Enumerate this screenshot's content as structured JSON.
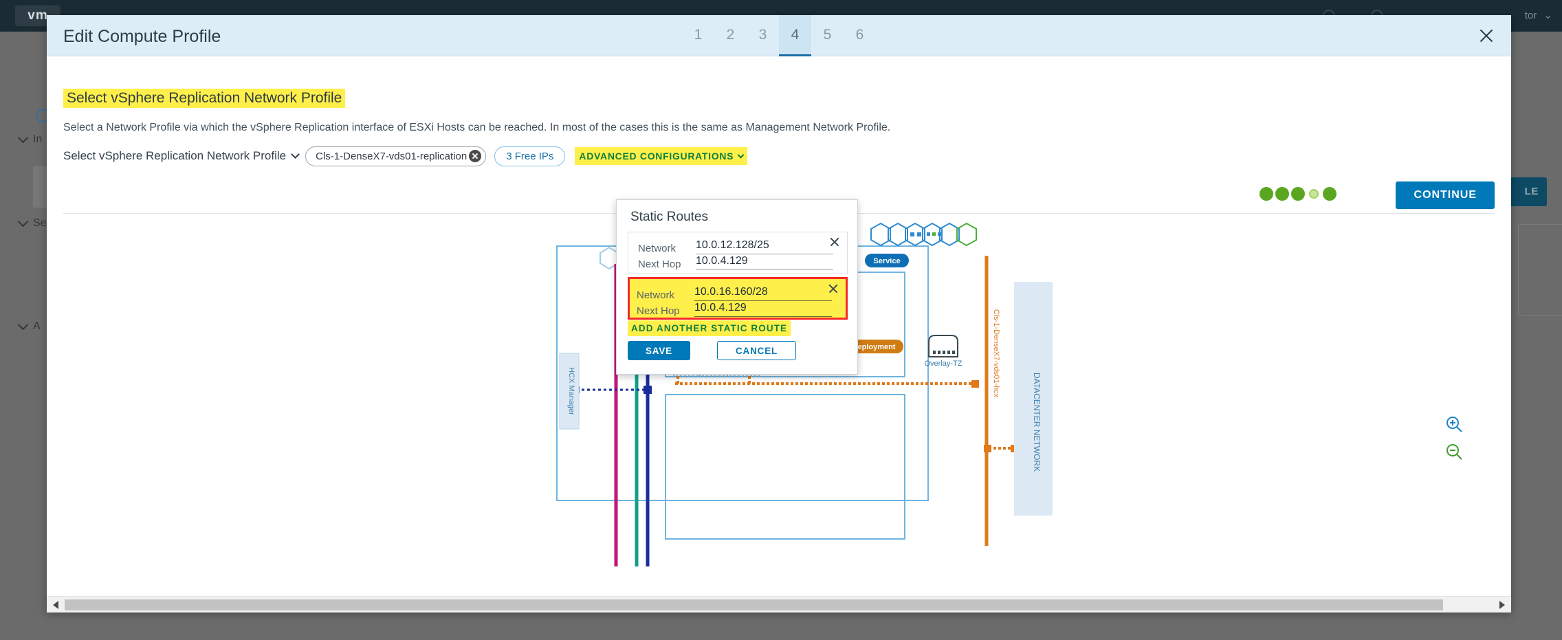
{
  "background": {
    "logo": "vm",
    "user_menu": "tor",
    "sidebar_items": [
      {
        "label": "In"
      },
      {
        "label": "Se"
      },
      {
        "label": "A"
      }
    ],
    "profile_button": "LE"
  },
  "modal": {
    "title": "Edit Compute Profile",
    "close_icon": "close-icon",
    "steps": [
      {
        "label": "1",
        "active": false
      },
      {
        "label": "2",
        "active": false
      },
      {
        "label": "3",
        "active": false
      },
      {
        "label": "4",
        "active": true
      },
      {
        "label": "5",
        "active": false
      },
      {
        "label": "6",
        "active": false
      }
    ],
    "section_title": "Select vSphere Replication Network Profile",
    "section_description": "Select a Network Profile via which the vSphere Replication interface of ESXi Hosts can be reached. In most of the cases this is the same as Management Network Profile.",
    "profile_selector_label": "Select vSphere Replication Network Profile",
    "selected_profile_chip": "Cls-1-DenseX7-vds01-replication",
    "free_ips_badge": "3 Free IPs",
    "advanced_configurations": "ADVANCED CONFIGURATIONS",
    "continue_button": "CONTINUE",
    "progress_dots": [
      {
        "state": "filled"
      },
      {
        "state": "filled"
      },
      {
        "state": "filled"
      },
      {
        "state": "hollow"
      },
      {
        "state": "filled"
      }
    ],
    "accent_color": "#0079b8",
    "highlight_color": "#ffef4a",
    "error_outline_color": "#f42a2a",
    "dot_color": "#5aa621"
  },
  "popover": {
    "title": "Static Routes",
    "routes": [
      {
        "network_label": "Network",
        "network_value": "10.0.12.128/25",
        "next_hop_label": "Next Hop",
        "next_hop_value": "10.0.4.129",
        "highlighted": false,
        "remove_icon": "close-icon"
      },
      {
        "network_label": "Network",
        "network_value": "10.0.16.160/28",
        "next_hop_label": "Next Hop",
        "next_hop_value": "10.0.4.129",
        "highlighted": true,
        "remove_icon": "close-icon"
      }
    ],
    "add_route_label": "ADD ANOTHER STATIC ROUTE",
    "save_label": "SAVE",
    "cancel_label": "CANCEL"
  },
  "diagram": {
    "service_badge": "Service",
    "deployment_badge": "Deployment",
    "overlay_tz_label": "Overlay-TZ",
    "hcx_manager_label": "HCX Manager",
    "vds_vertical_label": "Cls-1-DenseX7-vds01-hcx",
    "datacenter_label": "DATACENTER NETWORK",
    "zoom_in_icon": "zoom-in-icon",
    "zoom_out_icon": "zoom-out-icon"
  },
  "scrollbar": {
    "left_arrow_icon": "chevron-left-icon",
    "right_arrow_icon": "chevron-right-icon"
  }
}
